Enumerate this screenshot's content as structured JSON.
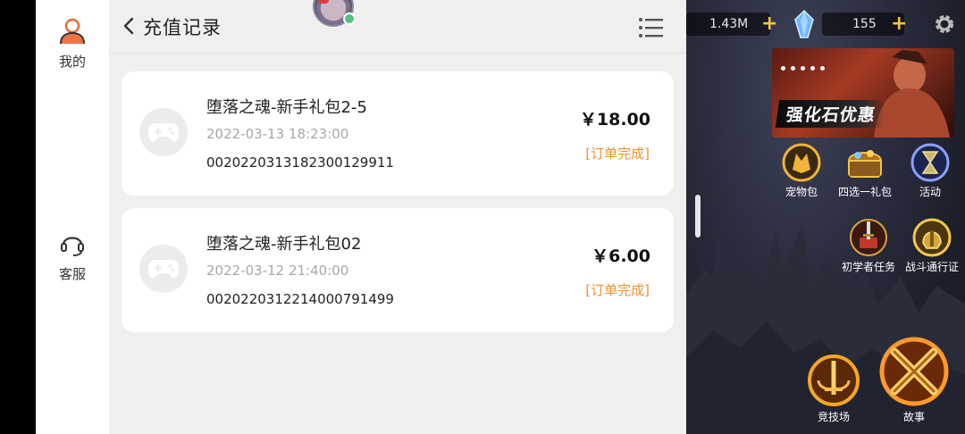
{
  "sidebar": {
    "mine_label": "我的",
    "service_label": "客服"
  },
  "header": {
    "title": "充值记录"
  },
  "records": [
    {
      "name": "堕落之魂-新手礼包2-5",
      "time": "2022-03-13 18:23:00",
      "order_no": "002022031318230012991​1",
      "price": "￥18.00",
      "status": "[订单完成]"
    },
    {
      "name": "堕落之魂-新手礼包02",
      "time": "2022-03-12 21:40:00",
      "order_no": "002022031221400079149​9",
      "price": "￥6.00",
      "status": "[订单完成]"
    }
  ],
  "game": {
    "resource_gold": "1.43M",
    "resource_gem": "155",
    "promo_title": "强化石优惠",
    "icons": {
      "pet": "宠物包",
      "choose_gift": "四选一礼包",
      "event": "活动",
      "newbie": "初学者任务",
      "pass": "战斗通行证",
      "arena": "竞技场",
      "story": "故事"
    }
  },
  "colors": {
    "accent_status": "#f0912e",
    "sidebar_icon": "#f0642f"
  }
}
